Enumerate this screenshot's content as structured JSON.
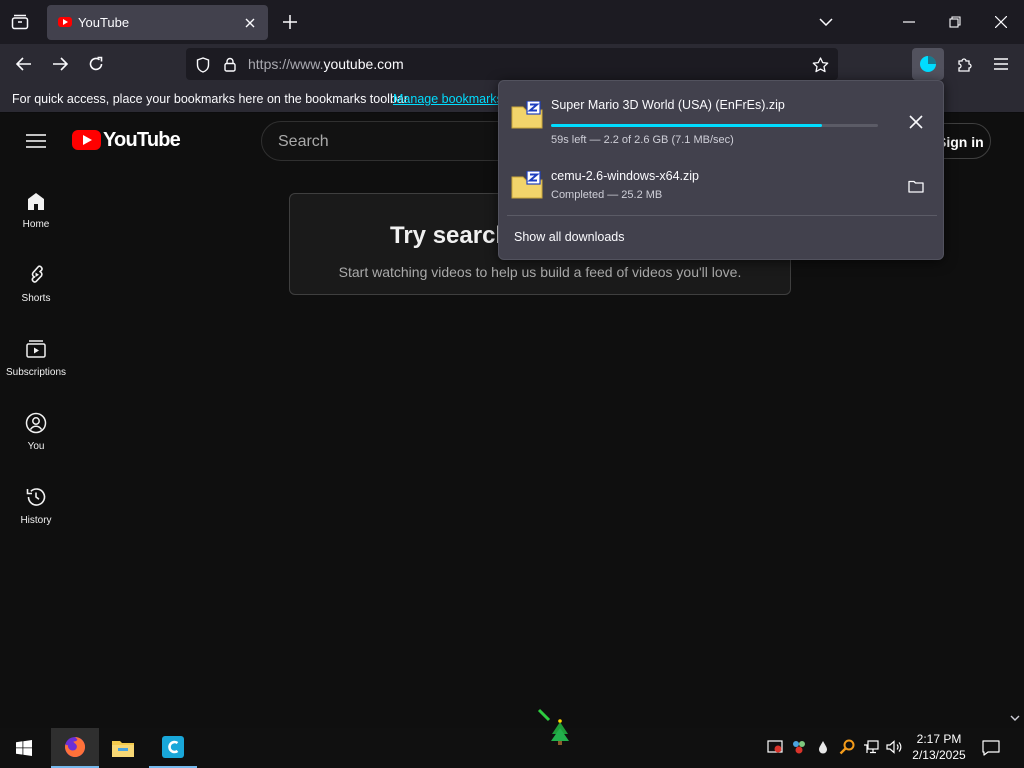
{
  "browser": {
    "tab": {
      "title": "YouTube"
    },
    "url": {
      "prefix": "https://www.",
      "domain": "youtube.com"
    },
    "bookmarks_bar": {
      "message": "For quick access, place your bookmarks here on the bookmarks toolbar.",
      "link": "Manage bookmarks"
    }
  },
  "youtube": {
    "logo_text": "YouTube",
    "search_placeholder": "Search",
    "sign_in": "Sign in",
    "sidebar": [
      {
        "label": "Home",
        "icon": "home-icon"
      },
      {
        "label": "Shorts",
        "icon": "shorts-icon"
      },
      {
        "label": "Subscriptions",
        "icon": "subscriptions-icon"
      },
      {
        "label": "You",
        "icon": "you-icon"
      },
      {
        "label": "History",
        "icon": "history-icon"
      }
    ],
    "empty_state": {
      "title": "Try searching to get started",
      "subtitle": "Start watching videos to help us build a feed of videos you'll love."
    }
  },
  "downloads": {
    "items": [
      {
        "name": "Super Mario 3D World (USA) (EnFrEs).zip",
        "status": "59s left — 2.2 of 2.6 GB (7.1 MB/sec)",
        "progress": 0.83
      },
      {
        "name": "cemu-2.6-windows-x64.zip",
        "status": "Completed — 25.2 MB"
      }
    ],
    "show_all": "Show all downloads"
  },
  "taskbar": {
    "time": "2:17 PM",
    "date": "2/13/2025"
  },
  "colors": {
    "accent": "#00ddff",
    "youtube_red": "#ff0000"
  }
}
